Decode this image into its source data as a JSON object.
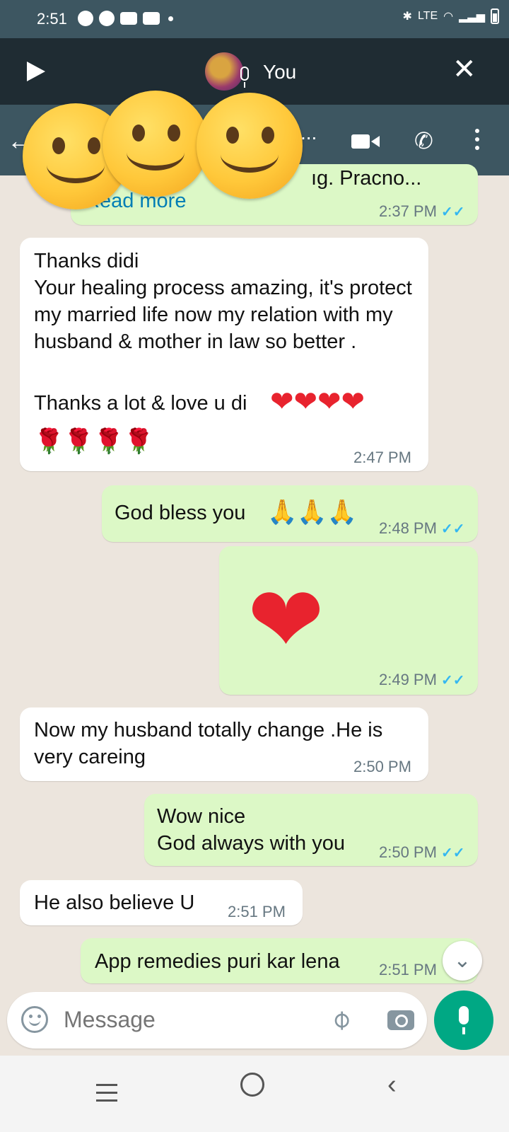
{
  "status_bar": {
    "time": "2:51",
    "signal_text": "LTE"
  },
  "call_bar": {
    "caller_name": "You"
  },
  "header": {
    "ellipsis": "..."
  },
  "messages": [
    {
      "direction": "out",
      "partial_text": "ıg. Pracno...",
      "read_more": "Read more",
      "time": "2:37 PM"
    },
    {
      "direction": "in",
      "text": "Thanks didi\nYour healing process amazing, it's protect my married life now my relation with my husband & mother in law so better .",
      "text2": "Thanks a lot & love u di",
      "hearts": "❤❤❤❤",
      "roses": "🌹🌹🌹🌹",
      "time": "2:47 PM"
    },
    {
      "direction": "out",
      "text": "God bless you",
      "emojis": "🙏🙏🙏",
      "time": "2:48 PM"
    },
    {
      "direction": "out",
      "emoji_large": "❤",
      "time": "2:49 PM"
    },
    {
      "direction": "in",
      "text": "Now my husband totally change .He is very careing",
      "time": "2:50 PM"
    },
    {
      "direction": "out",
      "text": "Wow nice\nGod always with you",
      "time": "2:50 PM"
    },
    {
      "direction": "in",
      "text": "He also believe U",
      "time": "2:51 PM"
    },
    {
      "direction": "out",
      "text": "App remedies puri kar lena",
      "time": "2:51 PM"
    }
  ],
  "read_ticks": "✓✓",
  "composer": {
    "placeholder": "Message"
  },
  "colors": {
    "header": "#3D5661",
    "incoming": "#FFFFFF",
    "outgoing": "#DCF8C6",
    "read_ticks": "#34B7F1",
    "mic_button": "#00A884"
  }
}
